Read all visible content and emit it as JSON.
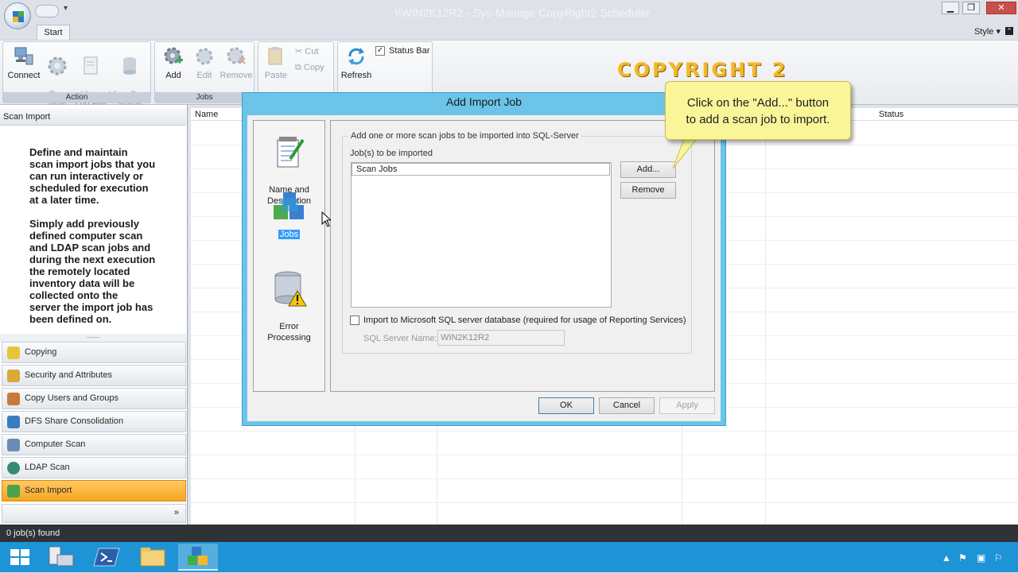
{
  "window": {
    "title": "\\\\WIN2K12R2 - Sys-Manage CopyRight2 Scheduler",
    "minimize": "▁",
    "maximize": "❐",
    "close": "✕"
  },
  "ribbon": {
    "tab_start": "Start",
    "style_menu": "Style ▾",
    "groups": {
      "action": {
        "label": "Action",
        "connect": "Connect",
        "run_now": "Run\nNow",
        "view_log": "View\nLog File",
        "view_scan": "View Scan\nStatus"
      },
      "jobs": {
        "label": "Jobs",
        "add": "Add",
        "edit": "Edit",
        "remove": "Remove"
      },
      "clipboard": {
        "paste": "Paste",
        "cut": "Cut",
        "copy": "Copy"
      },
      "view": {
        "refresh": "Refresh",
        "status_bar": "Status Bar",
        "status_bar_checked": true
      }
    }
  },
  "brand": "COPYRIGHT 2",
  "left_panel": {
    "header": "Scan Import",
    "description": "Define and maintain\nscan import jobs that you\ncan run interactively or\nscheduled for execution\nat a later time.\n\nSimply add previously\ndefined computer scan\nand LDAP scan jobs and\nduring the next execution\nthe remotely located\ninventory data will be\ncollected onto the\nserver the import job has\nbeen defined on.",
    "splitter": "........",
    "nav": [
      {
        "label": "Copying",
        "color": "#e8c43a"
      },
      {
        "label": "Security and Attributes",
        "color": "#d9a93a"
      },
      {
        "label": "Copy Users and Groups",
        "color": "#c97a3a"
      },
      {
        "label": "DFS Share Consolidation",
        "color": "#3a7bbf"
      },
      {
        "label": "Computer Scan",
        "color": "#6a8cb4"
      },
      {
        "label": "LDAP Scan",
        "color": "#3a8a6e"
      },
      {
        "label": "Scan Import",
        "color": "#4aa34a"
      }
    ],
    "more": "»"
  },
  "grid": {
    "col_name": "Name",
    "col_status": "Status"
  },
  "dialog": {
    "title": "Add Import Job",
    "side": {
      "name_desc": "Name and\nDescription",
      "jobs": "Jobs",
      "error": "Error\nProcessing"
    },
    "group_title": "Add one or more scan jobs to be imported into SQL-Server",
    "jobs_label": "Job(s) to be imported",
    "jobs_column": "Scan Jobs",
    "add_button": "Add...",
    "remove_button": "Remove",
    "import_checkbox": "Import to Microsoft SQL server database (required for usage of Reporting Services)",
    "sql_label": "SQL Server Name:",
    "sql_value": "WIN2K12R2",
    "ok": "OK",
    "cancel": "Cancel",
    "apply": "Apply"
  },
  "callout": {
    "text": "Click on the \"Add...\" button\nto add a scan job to import."
  },
  "statusbar": {
    "text": "0 job(s) found"
  },
  "taskbar": {
    "accent": "#1e93d6"
  }
}
